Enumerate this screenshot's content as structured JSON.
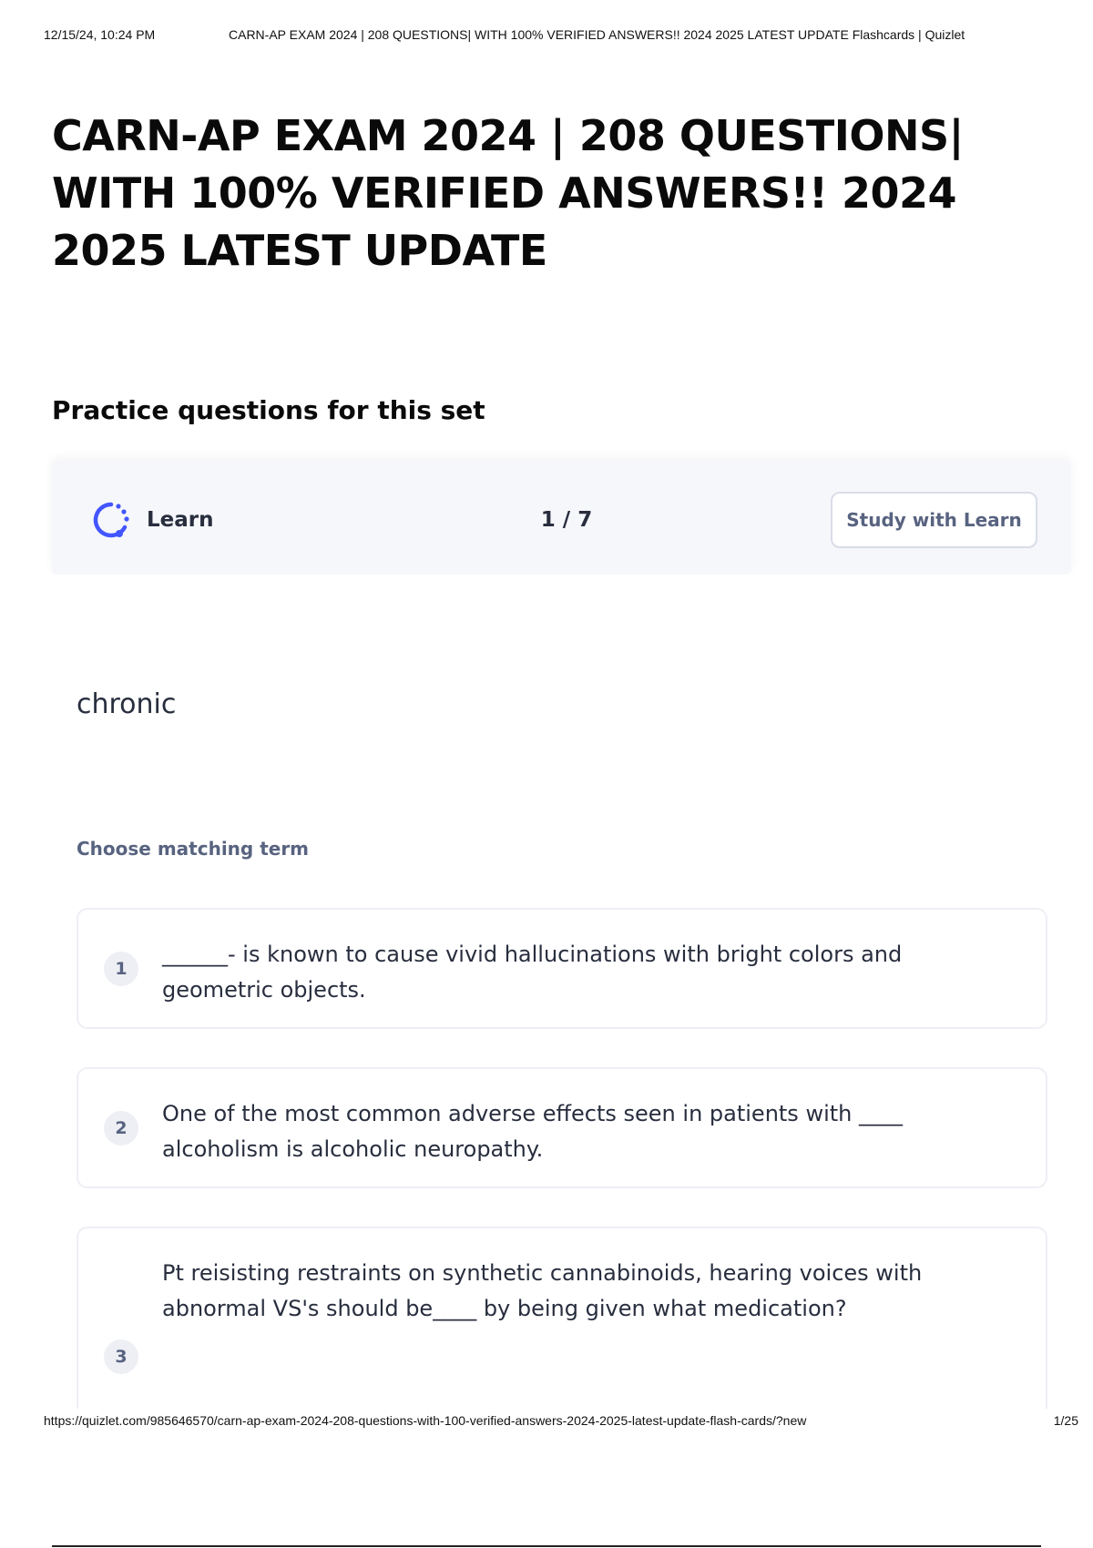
{
  "print_header": {
    "datetime": "12/15/24, 10:24 PM",
    "document_title": "CARN-AP EXAM 2024 | 208 QUESTIONS| WITH 100% VERIFIED ANSWERS!! 2024 2025 LATEST UPDATE Flashcards | Quizlet"
  },
  "page": {
    "title": "CARN-AP EXAM 2024 | 208 QUESTIONS| WITH 100% VERIFIED ANSWERS!! 2024 2025 LATEST UPDATE",
    "section_heading": "Practice questions for this set"
  },
  "learn_bar": {
    "icon": "learn-progress-icon",
    "label": "Learn",
    "progress": "1 / 7",
    "study_button": "Study with Learn",
    "accent_color": "#4255ff"
  },
  "question": {
    "term": "chronic",
    "instruction": "Choose matching term",
    "options": [
      {
        "number": "1",
        "text": "______- is known to cause vivid hallucinations with bright colors and geometric objects."
      },
      {
        "number": "2",
        "text": "One of the most common adverse effects seen in patients with ____ alcoholism is alcoholic neuropathy."
      },
      {
        "number": "3",
        "text": "Pt reisisting restraints on synthetic cannabinoids, hearing voices with abnormal VS's should be____ by being given what medication?"
      }
    ]
  },
  "print_footer": {
    "url": "https://quizlet.com/985646570/carn-ap-exam-2024-208-questions-with-100-verified-answers-2024-2025-latest-update-flash-cards/?new",
    "page": "1/25"
  }
}
